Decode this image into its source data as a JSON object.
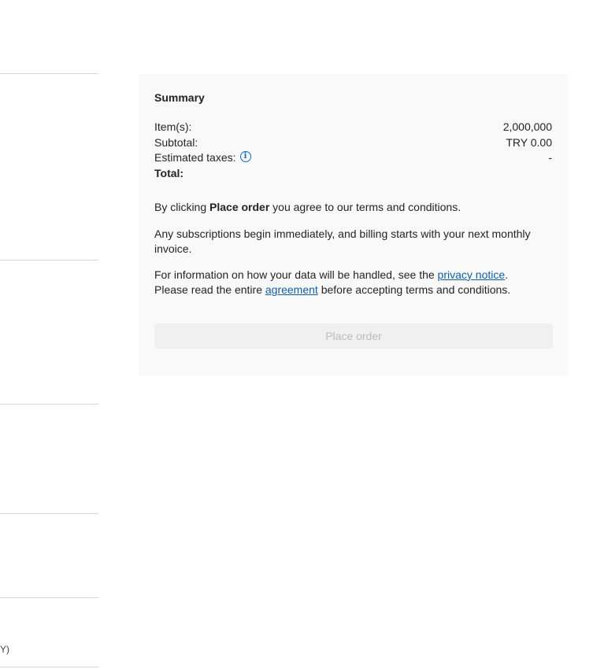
{
  "left_column": {
    "fragment_text": "Y)"
  },
  "summary": {
    "title": "Summary",
    "rows": [
      {
        "label": "Item(s):",
        "value": "2,000,000"
      },
      {
        "label": "Subtotal:",
        "value": "TRY 0.00"
      },
      {
        "label": "Estimated taxes:",
        "value": "-",
        "icon": "info-icon"
      },
      {
        "label": "Total:",
        "value": ""
      }
    ],
    "terms": {
      "prefix": "By clicking ",
      "emphasis": "Place order",
      "suffix": " you agree to our terms and conditions."
    },
    "billing_note": "Any subscriptions begin immediately, and billing starts with your next monthly invoice.",
    "data_note": {
      "prefix": "For information on how your data will be handled, see the ",
      "privacy_link": "privacy notice",
      "after_link": ".",
      "line2_prefix": "Please read the entire ",
      "agreement_link": "agreement",
      "line2_suffix": " before accepting terms and conditions."
    },
    "place_order_label": "Place order"
  },
  "colors": {
    "panel_bg": "#f9f9f9",
    "link": "#115ea3",
    "disabled_text": "#bdbdbd"
  }
}
